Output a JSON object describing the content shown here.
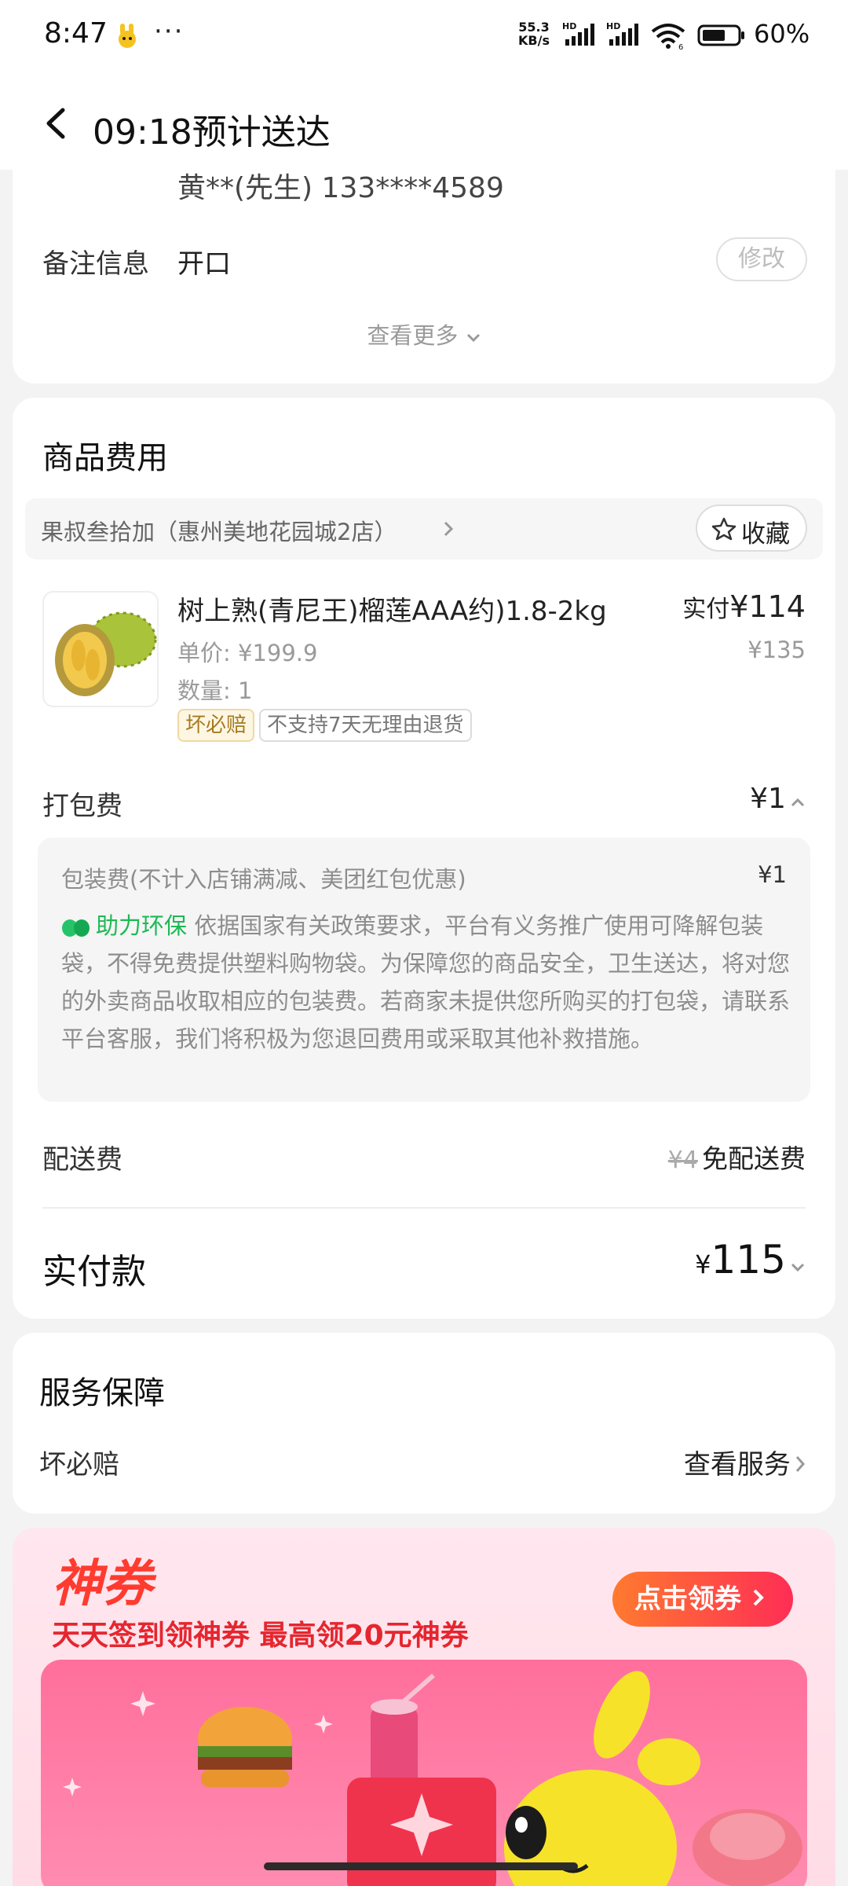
{
  "status_bar": {
    "time": "8:47",
    "dots": "···",
    "speed_top": "55.3",
    "speed_bottom": "KB/s",
    "hd1": "HD",
    "hd2": "HD",
    "battery_text": "60%"
  },
  "header": {
    "title": "09:18预计送达"
  },
  "address_card": {
    "contact": "黄**(先生) 133****4589",
    "remark_label": "备注信息",
    "remark_value": "开口",
    "edit_button": "修改",
    "see_more": "查看更多"
  },
  "fees_card": {
    "title": "商品费用",
    "store_name": "果叔叁拾加（惠州美地花园城2店）",
    "favorite_label": "收藏",
    "product": {
      "name": "树上熟(青尼王)榴莲AAA约)1.8-2kg",
      "unit_price": "单价: ¥199.9",
      "quantity": "数量: 1",
      "paid_label": "实付",
      "paid_price": "¥114",
      "original_price": "¥135",
      "tags": [
        "坏必赔",
        "不支持7天无理由退货"
      ]
    },
    "packing_fee": {
      "label": "打包费",
      "amount": "¥1",
      "detail_label": "包装费(不计入店铺满减、美团红包优惠)",
      "detail_amount": "¥1",
      "eco_label": "助力环保",
      "eco_text": "依据国家有关政策要求，平台有义务推广使用可降解包装袋，不得免费提供塑料购物袋。为保障您的商品安全，卫生送达，将对您的外卖商品收取相应的包装费。若商家未提供您所购买的打包袋，请联系平台客服，我们将积极为您退回费用或采取其他补救措施。"
    },
    "delivery_fee": {
      "label": "配送费",
      "original": "¥4",
      "value": "免配送费"
    },
    "total": {
      "label": "实付款",
      "currency": "¥",
      "amount": "115"
    }
  },
  "service_card": {
    "title": "服务保障",
    "item_label": "坏必赔",
    "item_action": "查看服务"
  },
  "banner": {
    "brand": "神券",
    "subtitle": "天天签到领神券 最高领20元神券",
    "cta": "点击领券"
  },
  "colors": {
    "accent_green": "#1db954",
    "tag_gold_text": "#a67b1e",
    "banner_red": "#ff3b2f"
  }
}
